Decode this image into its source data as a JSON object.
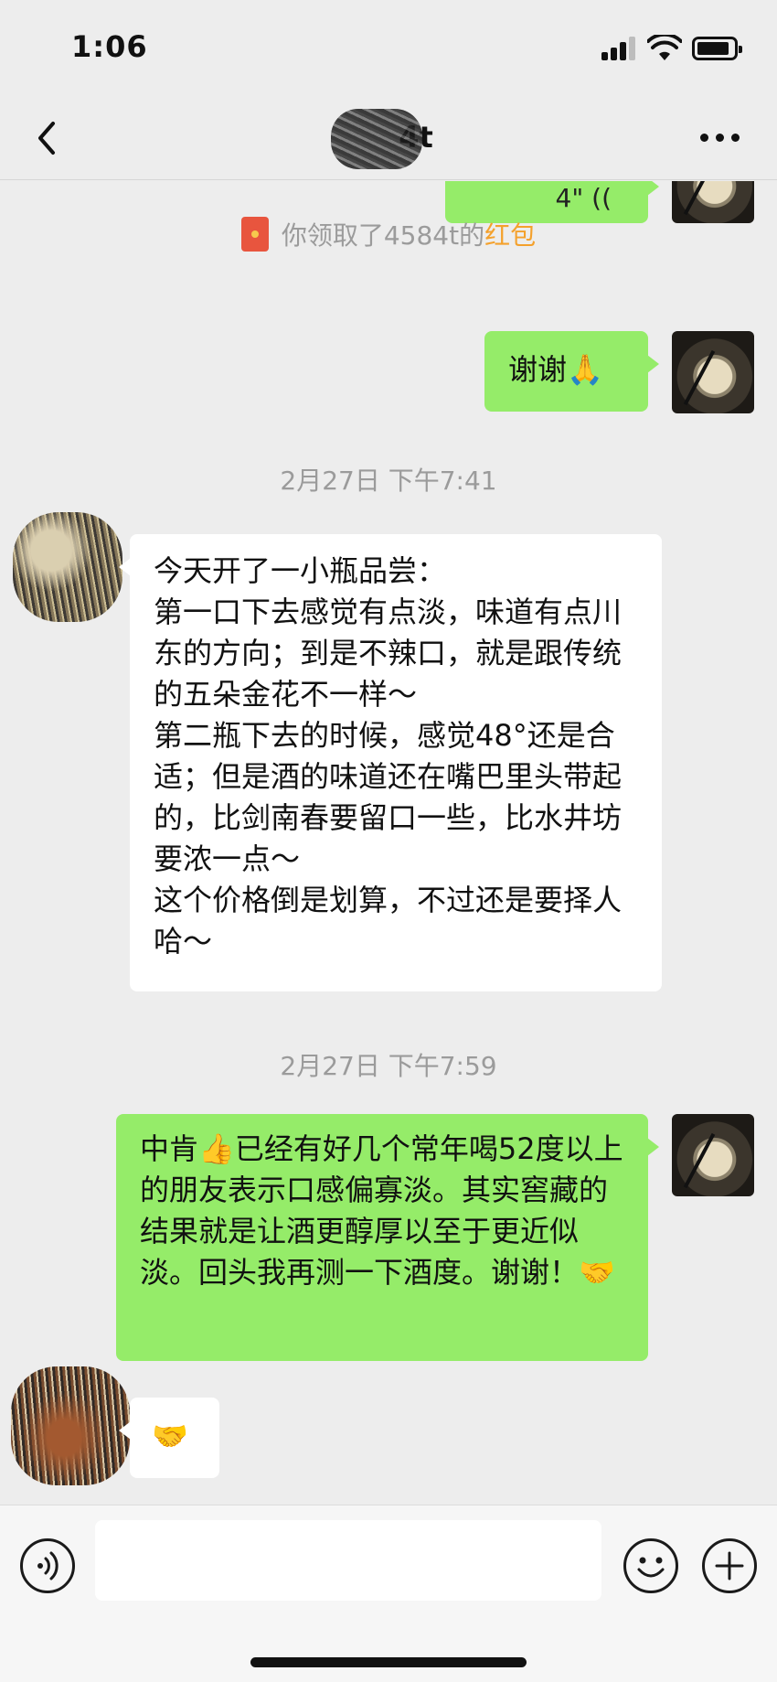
{
  "status_bar": {
    "time": "1:06"
  },
  "header": {
    "title": "4t"
  },
  "messages": {
    "voice_peek": "4\" ((",
    "red_packet_prefix": "你领取了4584t的",
    "red_packet_link": "红包",
    "thanks": "谢谢🙏",
    "timestamp_1": "2月27日 下午7:41",
    "tasting_note": "今天开了一小瓶品尝：\n第一口下去感觉有点淡，味道有点川东的方向；到是不辣口，就是跟传统的五朵金花不一样～\n第二瓶下去的时候，感觉48°还是合适；但是酒的味道还在嘴巴里头带起的，比剑南春要留口一些，比水井坊要浓一点～\n这个价格倒是划算，不过还是要择人哈～",
    "timestamp_2": "2月27日 下午7:59",
    "reply": "中肯👍已经有好几个常年喝52度以上的朋友表示口感偏寡淡。其实窖藏的结果就是让酒更醇厚以至于更近似淡。回头我再测一下酒度。谢谢！🤝",
    "handshake": "🤝"
  },
  "input_bar": {
    "placeholder": ""
  },
  "icons": [
    "back-icon",
    "more-icon",
    "red-packet-icon",
    "voice-icon",
    "emoji-icon",
    "plus-icon"
  ],
  "colors": {
    "outgoing_bubble": "#95ec69",
    "incoming_bubble": "#ffffff",
    "background": "#ededed",
    "red_packet_link": "#f4a12c"
  }
}
